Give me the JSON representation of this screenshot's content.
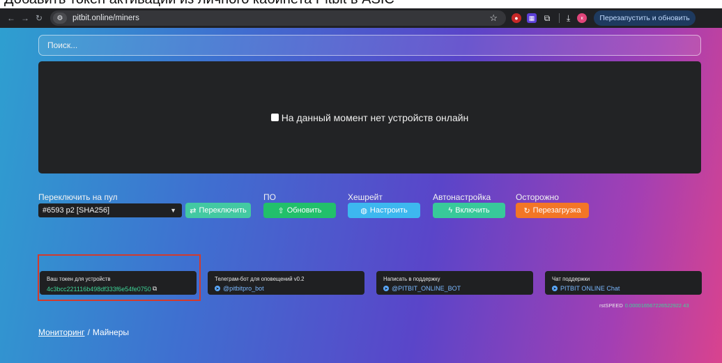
{
  "caption": "Добавить токен активации из личного кабинета Pitbit в ASIC",
  "browser": {
    "url": "pitbit.online/miners",
    "avatar_letter": "к",
    "restart_label": "Перезапустить и обновить",
    "icons": [
      "back-icon",
      "forward-icon",
      "reload-icon",
      "site-settings-icon",
      "star-icon",
      "extension-red-icon",
      "extension-purple-icon",
      "puzzle-icon",
      "download-icon"
    ]
  },
  "search": {
    "placeholder": "Поиск..."
  },
  "empty_state": {
    "text": "На данный момент нет устройств онлайн"
  },
  "controls": {
    "pool_label": "Переключить на пул",
    "pool_value": "#6593 p2 [SHA256]",
    "switch_button": "Переключить",
    "software_label": "ПО",
    "update_button": "Обновить",
    "hashrate_label": "Хешрейт",
    "configure_button": "Настроить",
    "autotune_label": "Автонастройка",
    "enable_button": "Включить",
    "caution_label": "Осторожно",
    "reboot_button": "Перезагрузка"
  },
  "cards": {
    "token": {
      "title": "Ваш токен для устройств",
      "value": "4c3bcc221116b498df333f6e54fe0750"
    },
    "telegram": {
      "title": "Телеграм-бот для оповещений v0.2",
      "value": "@pitbitpro_bot"
    },
    "support": {
      "title": "Написать в поддержку",
      "value": "@PITBIT_ONLINE_BOT"
    },
    "chat": {
      "title": "Чат поддержки",
      "value": "PITBIT ONLINE Chat"
    }
  },
  "rst": {
    "label": "rstSPEED",
    "value": "0.000016567226522922 43"
  },
  "breadcrumb": {
    "root": "Мониторинг",
    "sep": "/",
    "current": "Майнеры"
  },
  "colors": {
    "switch": "#43c9a2",
    "update": "#22c06b",
    "configure": "#3db8ef",
    "enable": "#38c99a",
    "reboot": "#f37626",
    "highlight": "#d33a2c"
  }
}
